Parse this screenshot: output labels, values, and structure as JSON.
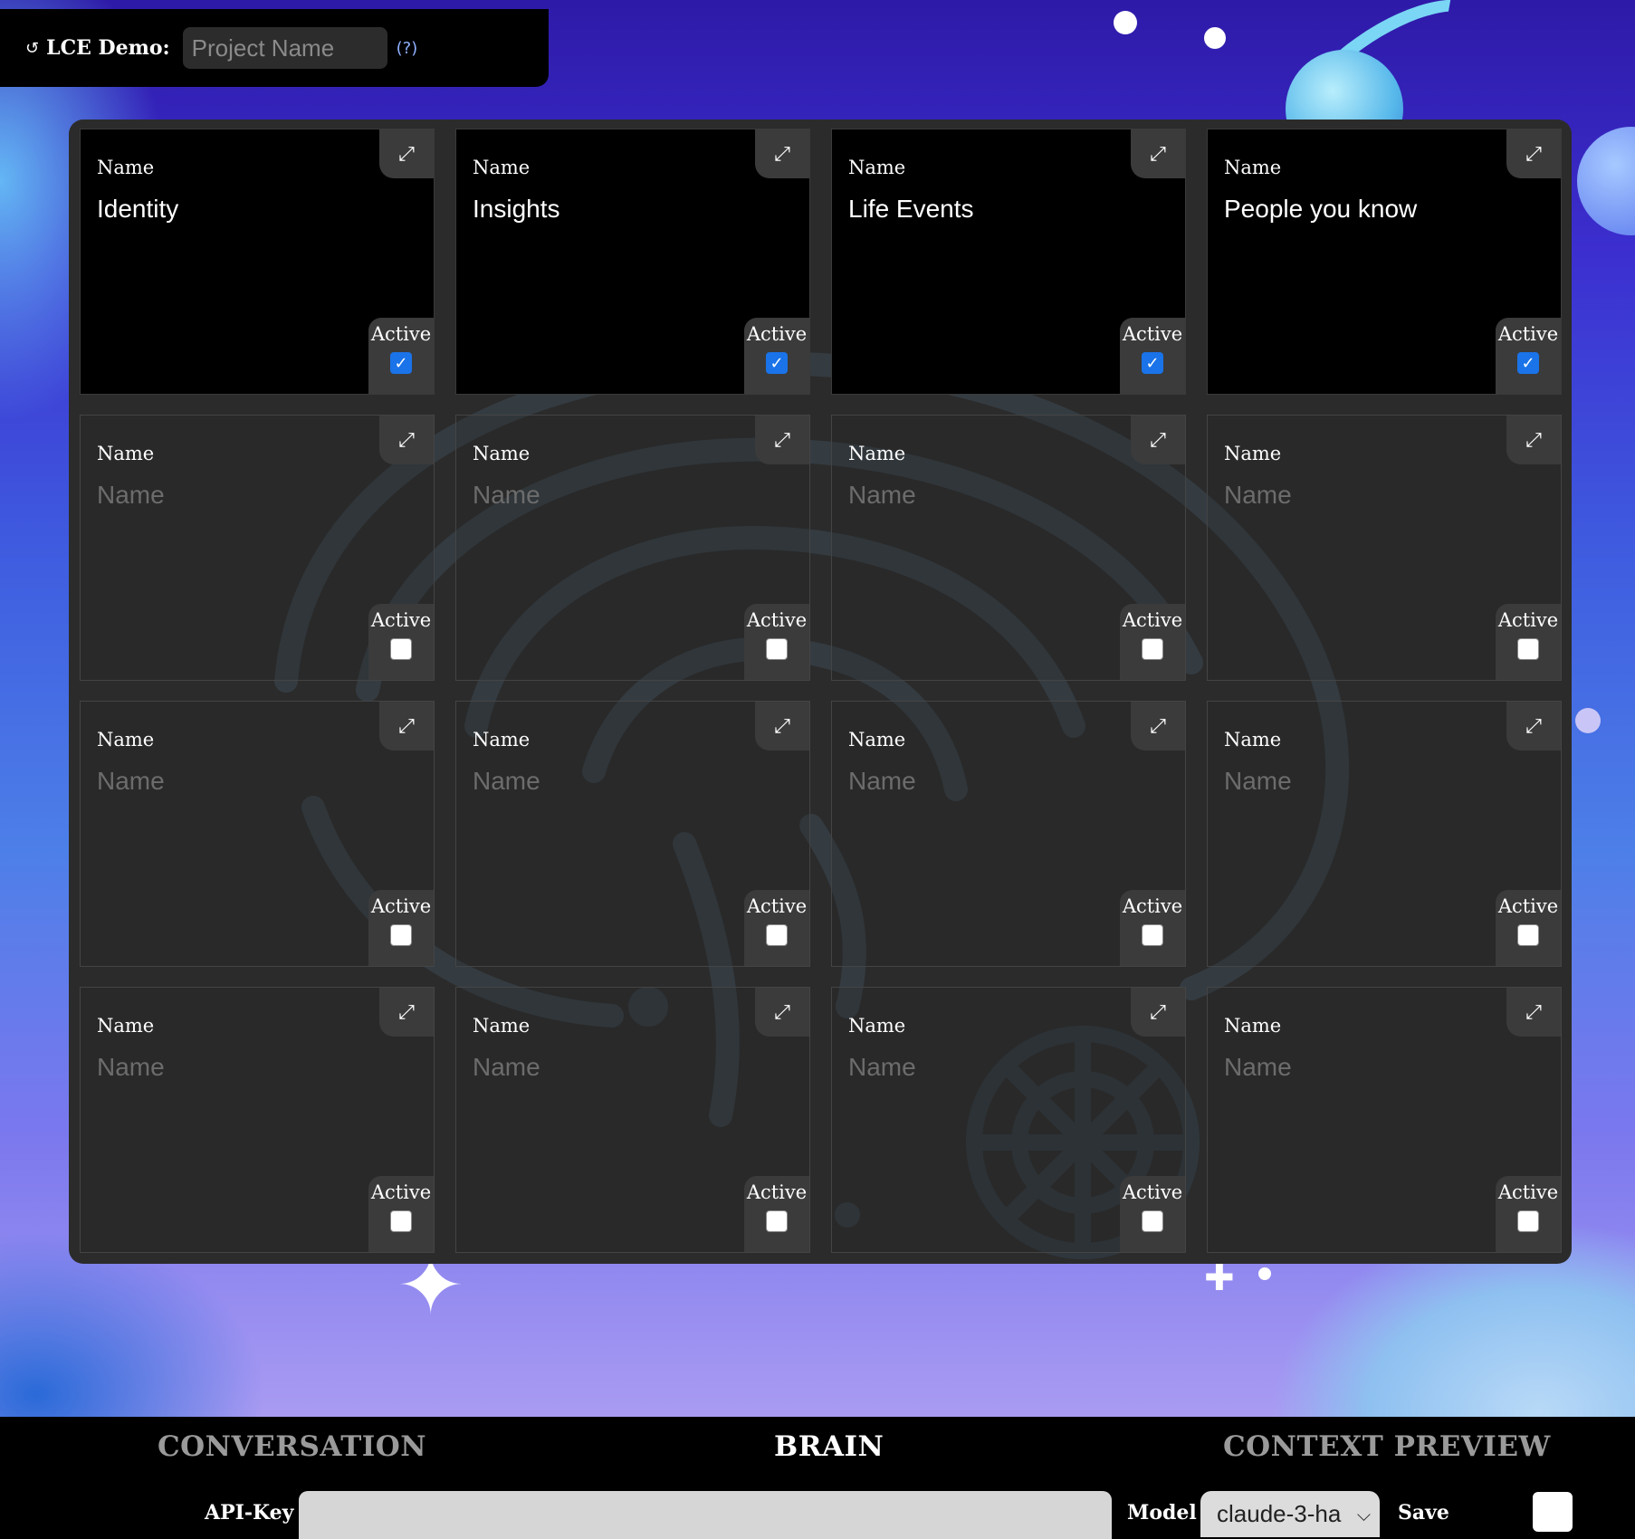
{
  "topbar": {
    "reload_icon": "↺",
    "title": "LCE Demo:",
    "project_placeholder": "Project Name",
    "help": "(?)"
  },
  "cards": [
    {
      "label": "Name",
      "value": "Identity",
      "placeholder": "Name",
      "active_label": "Active",
      "active": true
    },
    {
      "label": "Name",
      "value": "Insights",
      "placeholder": "Name",
      "active_label": "Active",
      "active": true
    },
    {
      "label": "Name",
      "value": "Life Events",
      "placeholder": "Name",
      "active_label": "Active",
      "active": true
    },
    {
      "label": "Name",
      "value": "People you know",
      "placeholder": "Name",
      "active_label": "Active",
      "active": true
    },
    {
      "label": "Name",
      "value": "",
      "placeholder": "Name",
      "active_label": "Active",
      "active": false
    },
    {
      "label": "Name",
      "value": "",
      "placeholder": "Name",
      "active_label": "Active",
      "active": false
    },
    {
      "label": "Name",
      "value": "",
      "placeholder": "Name",
      "active_label": "Active",
      "active": false
    },
    {
      "label": "Name",
      "value": "",
      "placeholder": "Name",
      "active_label": "Active",
      "active": false
    },
    {
      "label": "Name",
      "value": "",
      "placeholder": "Name",
      "active_label": "Active",
      "active": false
    },
    {
      "label": "Name",
      "value": "",
      "placeholder": "Name",
      "active_label": "Active",
      "active": false
    },
    {
      "label": "Name",
      "value": "",
      "placeholder": "Name",
      "active_label": "Active",
      "active": false
    },
    {
      "label": "Name",
      "value": "",
      "placeholder": "Name",
      "active_label": "Active",
      "active": false
    },
    {
      "label": "Name",
      "value": "",
      "placeholder": "Name",
      "active_label": "Active",
      "active": false
    },
    {
      "label": "Name",
      "value": "",
      "placeholder": "Name",
      "active_label": "Active",
      "active": false
    },
    {
      "label": "Name",
      "value": "",
      "placeholder": "Name",
      "active_label": "Active",
      "active": false
    },
    {
      "label": "Name",
      "value": "",
      "placeholder": "Name",
      "active_label": "Active",
      "active": false
    }
  ],
  "icons": {
    "expand": "expand-icon",
    "checkmark": "checkmark-icon",
    "chevron": "chevron-down-icon"
  },
  "tabs": {
    "conversation": "CONVERSATION",
    "brain": "BRAIN",
    "context_preview": "CONTEXT PREVIEW",
    "current": "BRAIN"
  },
  "bottombar": {
    "api_key_label": "API-Key",
    "api_key_value": "",
    "model_label": "Model",
    "model_value": "claude-3-ha",
    "save_label": "Save"
  },
  "colors": {
    "checkbox_accent": "#1a73e8",
    "tab_inactive": "#9a9a9a",
    "tab_active": "#ffffff"
  }
}
